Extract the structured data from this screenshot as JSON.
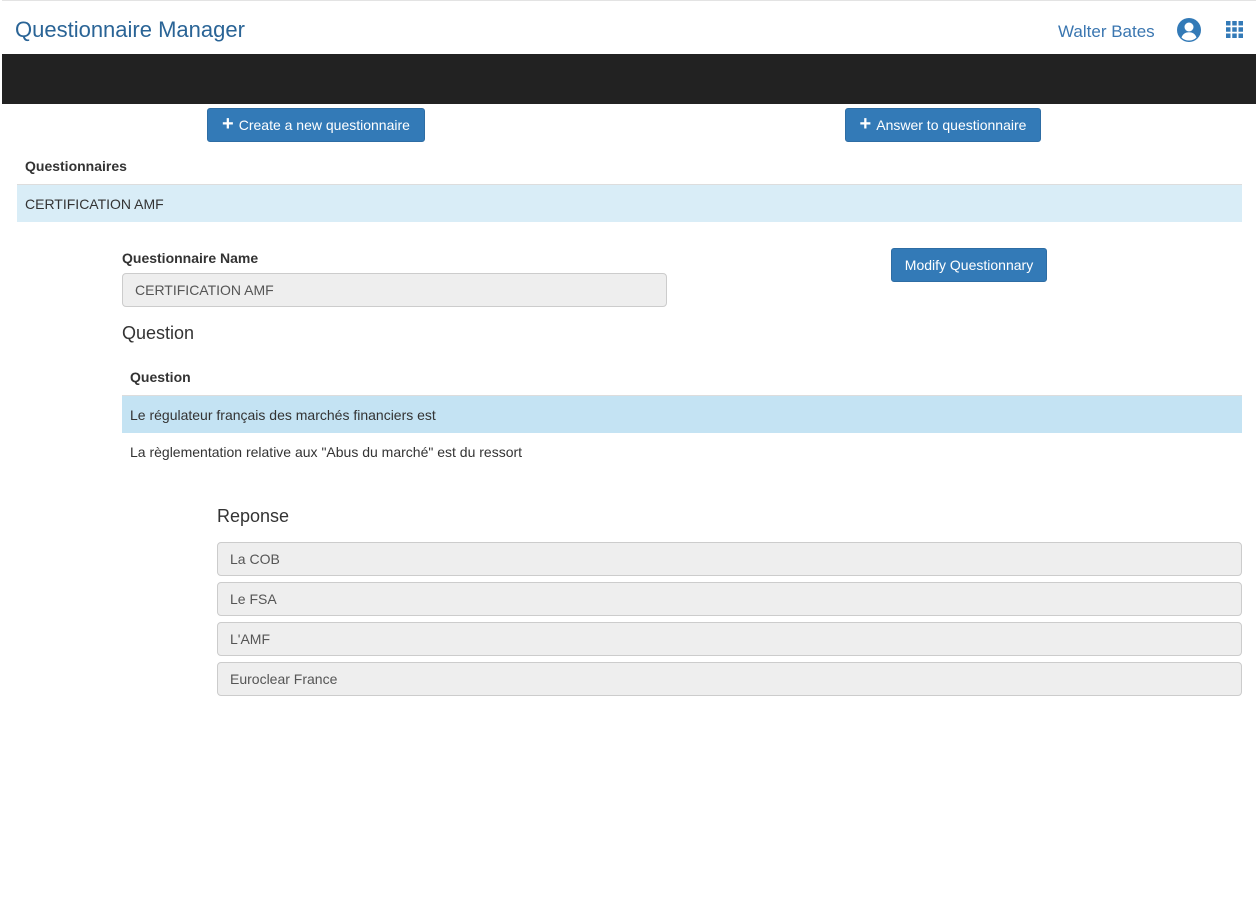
{
  "header": {
    "app_title": "Questionnaire Manager",
    "user_name": "Walter Bates",
    "user_icon": "user-circle-icon",
    "apps_icon": "grid-icon",
    "accent_color": "#337ab7",
    "navbar_color": "#222222"
  },
  "toolbar": {
    "create_label": "Create a new questionnaire",
    "answer_label": "Answer to questionnaire"
  },
  "questionnaires": {
    "header": "Questionnaires",
    "items": [
      "CERTIFICATION AMF"
    ]
  },
  "detail": {
    "name_label": "Questionnaire Name",
    "name_value": "CERTIFICATION AMF",
    "modify_label": "Modify Questionnary",
    "question_title": "Question",
    "question_table_header": "Question",
    "questions": [
      "Le régulateur français des marchés financiers est",
      "La règlementation relative aux \"Abus du marché\" est du ressort"
    ],
    "reponse_title": "Reponse",
    "answers": [
      "La COB",
      "Le FSA",
      "L'AMF",
      "Euroclear France"
    ]
  }
}
